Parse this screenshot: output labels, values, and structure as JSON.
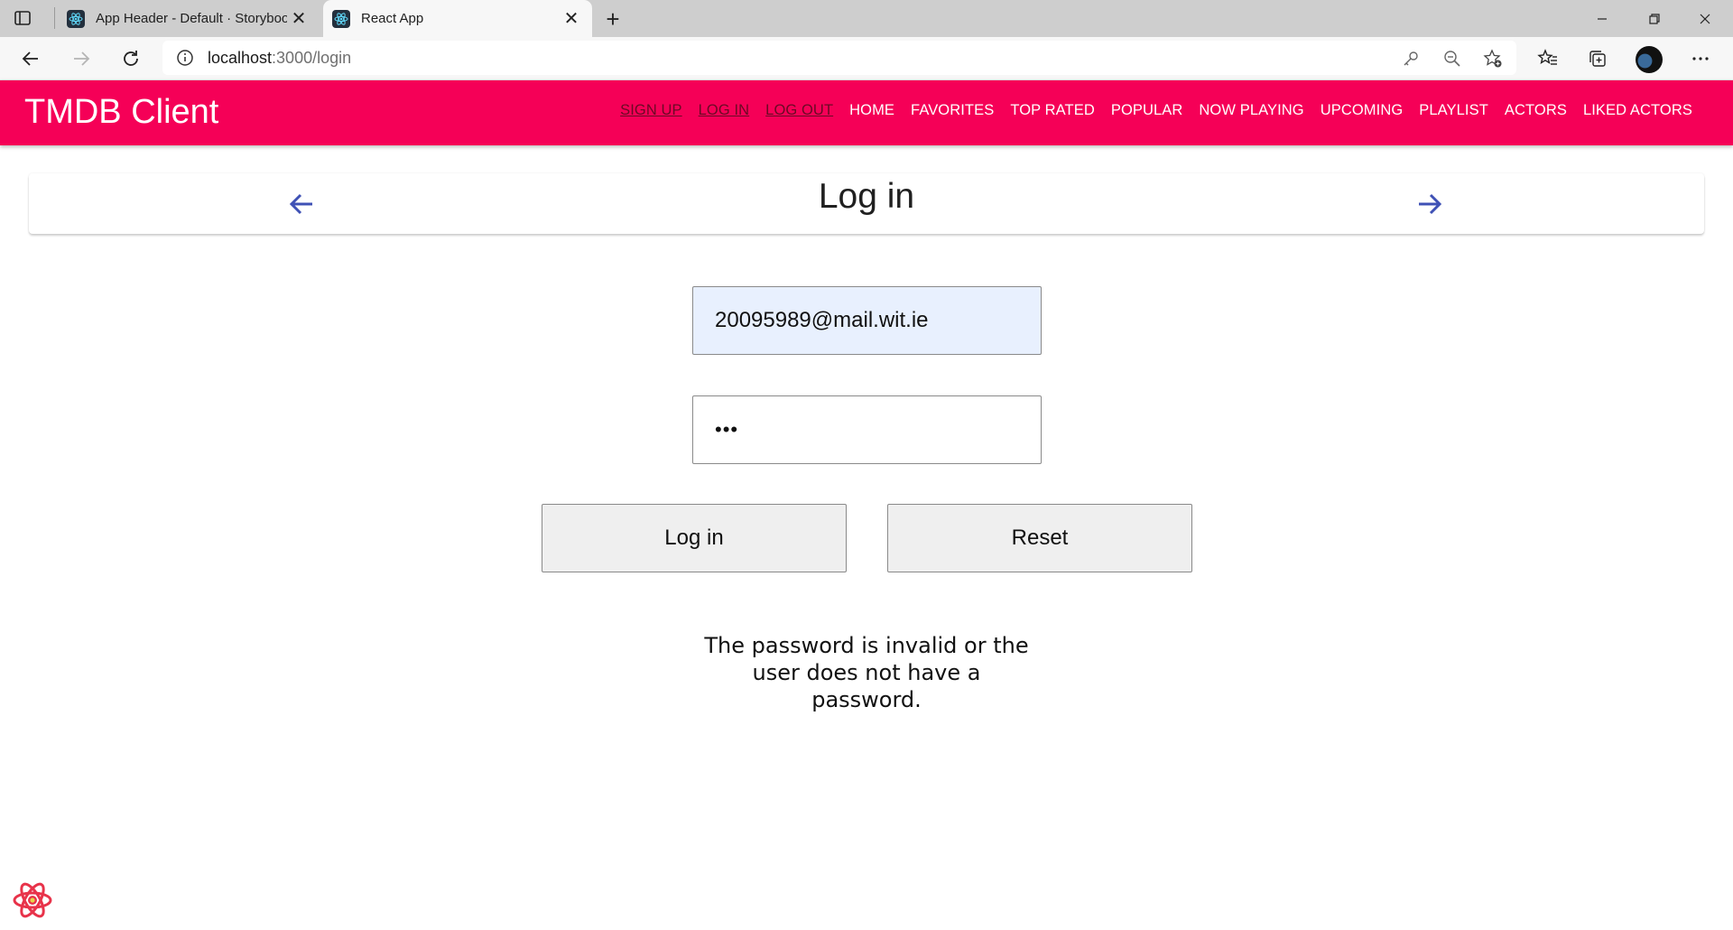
{
  "browser": {
    "tabs": [
      {
        "title": "App Header - Default · Storybook",
        "active": false
      },
      {
        "title": "React App",
        "active": true
      }
    ],
    "url": {
      "host": "localhost",
      "path": ":3000/login"
    }
  },
  "app": {
    "title": "TMDB Client",
    "brand_color": "#f50057",
    "menu": [
      {
        "label": "SIGN UP",
        "link": true
      },
      {
        "label": "LOG IN",
        "link": true
      },
      {
        "label": "LOG OUT",
        "link": true
      },
      {
        "label": "HOME",
        "link": false
      },
      {
        "label": "FAVORITES",
        "link": false
      },
      {
        "label": "TOP RATED",
        "link": false
      },
      {
        "label": "POPULAR",
        "link": false
      },
      {
        "label": "NOW PLAYING",
        "link": false
      },
      {
        "label": "UPCOMING",
        "link": false
      },
      {
        "label": "PLAYLIST",
        "link": false
      },
      {
        "label": "ACTORS",
        "link": false
      },
      {
        "label": "LIKED ACTORS",
        "link": false
      }
    ]
  },
  "page": {
    "title": "Log in",
    "arrow_color": "#3f51b5"
  },
  "form": {
    "email_value": "20095989@mail.wit.ie",
    "password_value": "•••",
    "login_label": "Log in",
    "reset_label": "Reset"
  },
  "error": {
    "line1": "The password is invalid or the",
    "line2": "user does not have a",
    "line3": "password."
  }
}
